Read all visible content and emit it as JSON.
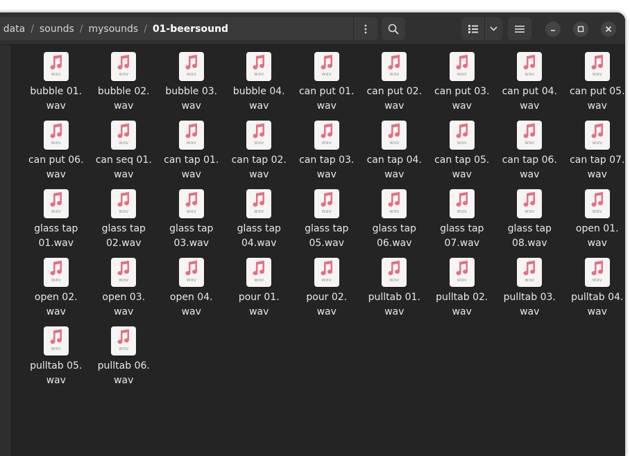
{
  "window": {
    "breadcrumb": [
      "data",
      "sounds",
      "mysounds",
      "01-beersound"
    ],
    "icons": {
      "path_menu": "vertical-dots-icon",
      "search": "magnifier-icon",
      "view_list": "list-view-icon",
      "view_dropdown": "chevron-down-icon",
      "main_menu": "hamburger-icon",
      "minimize": "minimize-icon",
      "maximize": "maximize-icon",
      "close": "close-icon"
    }
  },
  "colors": {
    "accent_music": "#e66e82",
    "window_bg": "#242424",
    "header_bg": "#303030"
  },
  "file_type_label": "wav",
  "files": [
    {
      "line1": "bubble 01.",
      "line2": "wav"
    },
    {
      "line1": "bubble 02.",
      "line2": "wav"
    },
    {
      "line1": "bubble 03.",
      "line2": "wav"
    },
    {
      "line1": "bubble 04.",
      "line2": "wav"
    },
    {
      "line1": "can put 01.",
      "line2": "wav"
    },
    {
      "line1": "can put 02.",
      "line2": "wav"
    },
    {
      "line1": "can put 03.",
      "line2": "wav"
    },
    {
      "line1": "can put 04.",
      "line2": "wav"
    },
    {
      "line1": "can put 05.",
      "line2": "wav"
    },
    {
      "line1": "can put 06.",
      "line2": "wav"
    },
    {
      "line1": "can seq 01.",
      "line2": "wav"
    },
    {
      "line1": "can tap 01.",
      "line2": "wav"
    },
    {
      "line1": "can tap 02.",
      "line2": "wav"
    },
    {
      "line1": "can tap 03.",
      "line2": "wav"
    },
    {
      "line1": "can tap 04.",
      "line2": "wav"
    },
    {
      "line1": "can tap 05.",
      "line2": "wav"
    },
    {
      "line1": "can tap 06.",
      "line2": "wav"
    },
    {
      "line1": "can tap 07.",
      "line2": "wav"
    },
    {
      "line1": "glass tap",
      "line2": "01.wav"
    },
    {
      "line1": "glass tap",
      "line2": "02.wav"
    },
    {
      "line1": "glass tap",
      "line2": "03.wav"
    },
    {
      "line1": "glass tap",
      "line2": "04.wav"
    },
    {
      "line1": "glass tap",
      "line2": "05.wav"
    },
    {
      "line1": "glass tap",
      "line2": "06.wav"
    },
    {
      "line1": "glass tap",
      "line2": "07.wav"
    },
    {
      "line1": "glass tap",
      "line2": "08.wav"
    },
    {
      "line1": "open 01.",
      "line2": "wav"
    },
    {
      "line1": "open 02.",
      "line2": "wav"
    },
    {
      "line1": "open 03.",
      "line2": "wav"
    },
    {
      "line1": "open 04.",
      "line2": "wav"
    },
    {
      "line1": "pour 01.",
      "line2": "wav"
    },
    {
      "line1": "pour 02.",
      "line2": "wav"
    },
    {
      "line1": "pulltab 01.",
      "line2": "wav"
    },
    {
      "line1": "pulltab 02.",
      "line2": "wav"
    },
    {
      "line1": "pulltab 03.",
      "line2": "wav"
    },
    {
      "line1": "pulltab 04.",
      "line2": "wav"
    },
    {
      "line1": "pulltab 05.",
      "line2": "wav"
    },
    {
      "line1": "pulltab 06.",
      "line2": "wav"
    }
  ]
}
